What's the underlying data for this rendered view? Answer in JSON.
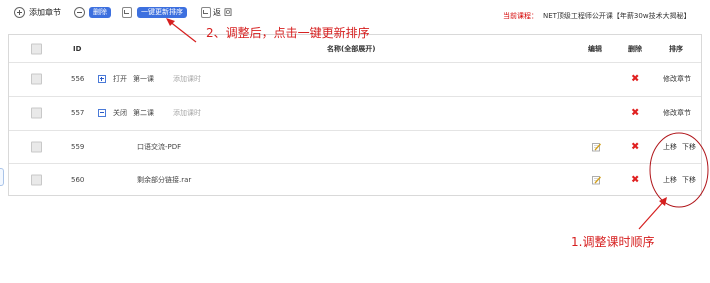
{
  "toolbar": {
    "add_chapter": "添加章节",
    "delete": "删除",
    "update_sort": "一键更新排序",
    "back": "返回",
    "course_label": "当前课程：",
    "course_name": "NET顶级工程师公开课【年薪30w技术大揭秘】"
  },
  "table": {
    "headers": {
      "id": "ID",
      "name": "名称(全部展开)",
      "edit": "编辑",
      "delete": "删除",
      "sort": "排序"
    },
    "rows": [
      {
        "id": "556",
        "toggle": "打开",
        "title": "第一课",
        "add_lesson": "添加课时",
        "sort_action": "修改章节"
      },
      {
        "id": "557",
        "toggle": "关闭",
        "title": "第二课",
        "add_lesson": "添加课时",
        "sort_action": "修改章节"
      },
      {
        "id": "559",
        "title": "口语交流-PDF",
        "move_up": "上移",
        "move_down": "下移"
      },
      {
        "id": "560",
        "title": "剩余部分链接.rar",
        "move_up": "上移",
        "move_down": "下移"
      }
    ]
  },
  "annotations": {
    "step2": "2、调整后，点击一键更新排序",
    "step1": "1.调整课时顺序",
    "color": "#d61f1f"
  },
  "icons": {
    "add": "plus-circle-icon",
    "remove": "minus-circle-icon",
    "back": "return-icon",
    "edit": "edit-note-icon",
    "delete": "red-x-icon"
  }
}
